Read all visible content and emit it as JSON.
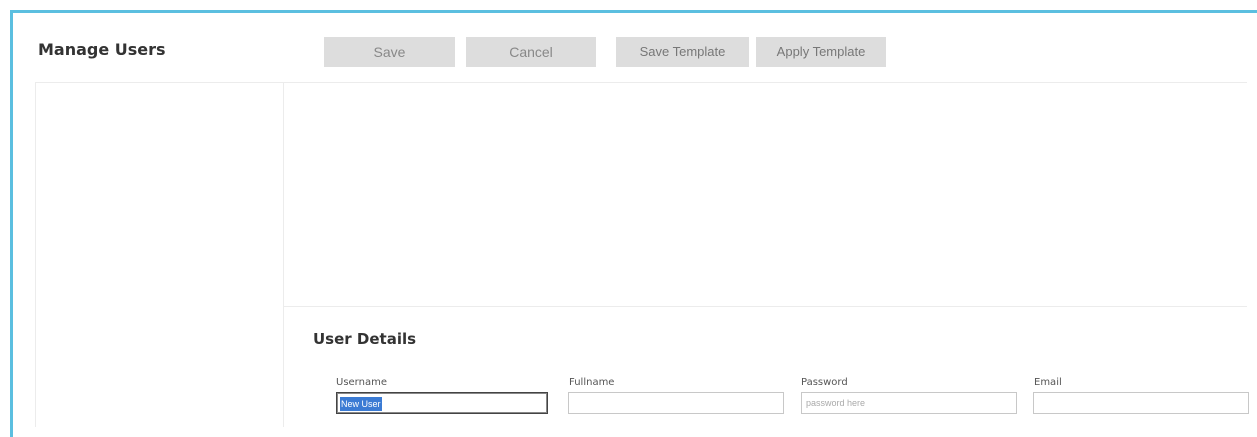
{
  "page": {
    "title": "Manage Users"
  },
  "toolbar": {
    "save_label": "Save",
    "cancel_label": "Cancel",
    "save_template_label": "Save Template",
    "apply_template_label": "Apply Template"
  },
  "user_details": {
    "heading": "User Details",
    "username": {
      "label": "Username",
      "value": "New User"
    },
    "fullname": {
      "label": "Fullname",
      "value": ""
    },
    "password": {
      "label": "Password",
      "placeholder": "password here",
      "value": ""
    },
    "email": {
      "label": "Email",
      "value": ""
    }
  },
  "colors": {
    "frame_border": "#5bbfe0",
    "button_bg": "#dddddd",
    "selection_bg": "#3b7bd4"
  }
}
